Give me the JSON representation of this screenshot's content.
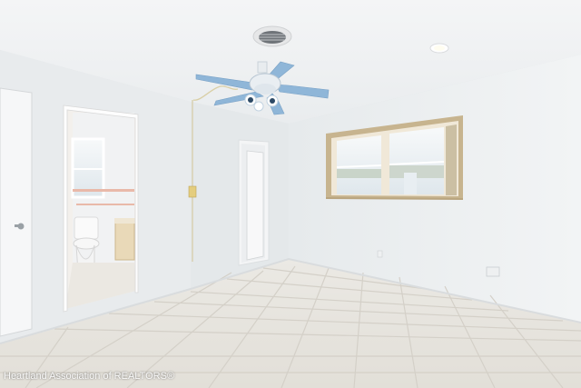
{
  "watermark": "Heartland Association of REALTORS®",
  "colors": {
    "wall": "#eceff1",
    "ceiling": "#f3f4f5",
    "floor_tile": "#e7e5e0",
    "grout": "#d6d3cc",
    "fan_blade": "#8fb6d8",
    "window_frame": "#c7b48f",
    "bath_accent": "#e9b9a9"
  }
}
